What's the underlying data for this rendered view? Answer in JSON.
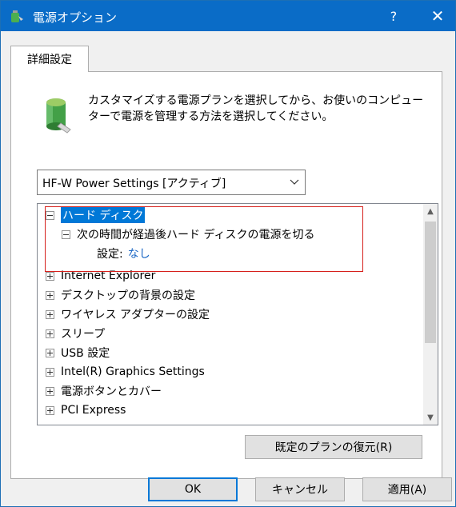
{
  "window": {
    "title": "電源オプション",
    "help": "?",
    "close": "✕"
  },
  "tab": {
    "label": "詳細設定"
  },
  "description": "カスタマイズする電源プランを選択してから、お使いのコンピューターで電源を管理する方法を選択してください。",
  "plan_select": {
    "value": "HF-W Power Settings [アクティブ]"
  },
  "tree": {
    "items": [
      {
        "label": "ハード ディスク",
        "expanded": true,
        "selected": true
      },
      {
        "label": "次の時間が経過後ハード ディスクの電源を切る",
        "expanded": true
      },
      {
        "label": "設定:",
        "value": "なし"
      },
      {
        "label": "Internet Explorer"
      },
      {
        "label": "デスクトップの背景の設定"
      },
      {
        "label": "ワイヤレス アダプターの設定"
      },
      {
        "label": "スリープ"
      },
      {
        "label": "USB 設定"
      },
      {
        "label": "Intel(R) Graphics Settings"
      },
      {
        "label": "電源ボタンとカバー"
      },
      {
        "label": "PCI Express"
      }
    ]
  },
  "buttons": {
    "restore": "既定のプランの復元(R)",
    "ok": "OK",
    "cancel": "キャンセル",
    "apply": "適用(A)"
  },
  "colors": {
    "titlebar": "#0a6cc7",
    "selection": "#0078d7",
    "highlight_box": "#d6201c",
    "value_link": "#1a66c4"
  }
}
